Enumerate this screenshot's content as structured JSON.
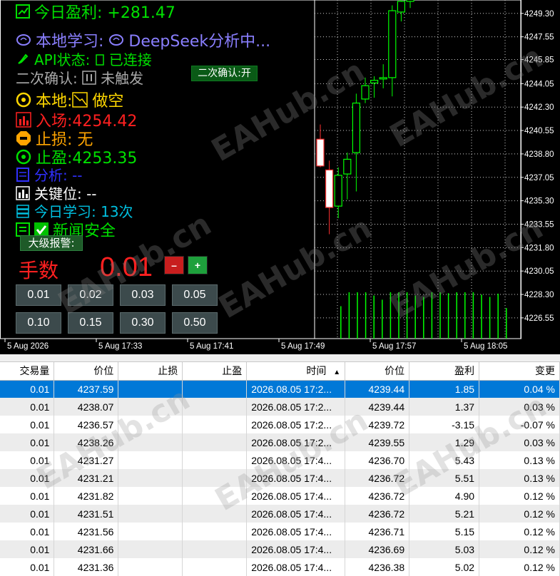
{
  "panel": {
    "profit_label": "今日盈利: +281.47",
    "ai_label": "本地学习: ",
    "ai_model": "DeepSeek分析中...",
    "api_label": "API状态: ",
    "api_status": "已连接",
    "confirm_label": "二次确认: ",
    "confirm_status": "未触发",
    "confirm_button": "二次确认:开",
    "local_label": "本地:",
    "local_status": "做空",
    "entry_label": "入场:4254.42",
    "sl_label": "止损: 无",
    "tp_label": "止盈:4253.35",
    "analysis_label": "分析: --",
    "key_label": "关键位: --",
    "learn_label": "今日学习: 13次",
    "news_label": "新闻安全",
    "alert_button": "大级报警:",
    "lots_label": "手数",
    "lots_value": "0.01",
    "minus": "–",
    "plus": "+",
    "lot_buttons": [
      "0.01",
      "0.02",
      "0.03",
      "0.05",
      "0.10",
      "0.15",
      "0.30",
      "0.50"
    ]
  },
  "colors": {
    "profit": "#00e000",
    "ai": "#8a7fff",
    "api": "#00e000",
    "confirm": "#aaaaaa",
    "local": "#ffd700",
    "entry": "#ff2020",
    "sl": "#ffa500",
    "tp": "#00e000",
    "analysis": "#3030ff",
    "key": "#ffffff",
    "learn": "#00c0e0",
    "news": "#00e000",
    "bull": "#00ff00",
    "bear": "#ff3030"
  },
  "chart_data": {
    "type": "candlestick",
    "price_ticks": [
      "4249.30",
      "4247.55",
      "4245.85",
      "4244.05",
      "4242.30",
      "4240.55",
      "4238.80",
      "4237.05",
      "4235.30",
      "4233.55",
      "4231.80",
      "4230.05",
      "4228.30",
      "4226.55"
    ],
    "time_ticks": [
      "5 Aug 2026",
      "5 Aug 17:33",
      "5 Aug 17:41",
      "5 Aug 17:49",
      "5 Aug 17:57",
      "5 Aug 18:05"
    ],
    "ylim": [
      4225.0,
      4250.3
    ],
    "candles": [
      {
        "o": 4239.9,
        "h": 4241.0,
        "l": 4237.8,
        "c": 4237.9
      },
      {
        "o": 4237.6,
        "h": 4238.3,
        "l": 4232.8,
        "c": 4234.8
      },
      {
        "o": 4234.9,
        "h": 4237.8,
        "l": 4234.0,
        "c": 4237.2
      },
      {
        "o": 4237.3,
        "h": 4238.9,
        "l": 4235.4,
        "c": 4238.4
      },
      {
        "o": 4238.9,
        "h": 4243.3,
        "l": 4236.0,
        "c": 4242.6
      },
      {
        "o": 4242.9,
        "h": 4244.5,
        "l": 4242.6,
        "c": 4243.9
      },
      {
        "o": 4244.1,
        "h": 4244.6,
        "l": 4243.0,
        "c": 4244.3
      },
      {
        "o": 4244.4,
        "h": 4245.5,
        "l": 4243.7,
        "c": 4244.5
      },
      {
        "o": 4244.5,
        "h": 4249.9,
        "l": 4243.1,
        "c": 4249.5
      },
      {
        "o": 4249.4,
        "h": 4250.6,
        "l": 4248.7,
        "c": 4250.2
      },
      {
        "o": 4250.2,
        "h": 4250.9,
        "l": 4249.7,
        "c": 4250.6
      }
    ],
    "volumes": [
      0,
      0,
      0,
      0.7,
      1,
      1,
      1,
      0.93,
      0.84,
      1,
      1,
      1,
      0.93,
      0.9,
      1,
      1,
      0.98,
      1,
      1,
      1,
      0.95,
      0.9,
      0.97,
      0.66
    ]
  },
  "table": {
    "headers": [
      "交易量",
      "价位",
      "止损",
      "止盈",
      "时间",
      "价位",
      "盈利",
      "变更"
    ],
    "sort_indicator": "▲",
    "rows": [
      [
        "0.01",
        "4237.59",
        "",
        "",
        "2026.08.05 17:2...",
        "4239.44",
        "1.85",
        "0.04 %"
      ],
      [
        "0.01",
        "4238.07",
        "",
        "",
        "2026.08.05 17:2...",
        "4239.44",
        "1.37",
        "0.03 %"
      ],
      [
        "0.01",
        "4236.57",
        "",
        "",
        "2026.08.05 17:2...",
        "4239.72",
        "-3.15",
        "-0.07 %"
      ],
      [
        "0.01",
        "4238.26",
        "",
        "",
        "2026.08.05 17:2...",
        "4239.55",
        "1.29",
        "0.03 %"
      ],
      [
        "0.01",
        "4231.27",
        "",
        "",
        "2026.08.05 17:4...",
        "4236.70",
        "5.43",
        "0.13 %"
      ],
      [
        "0.01",
        "4231.21",
        "",
        "",
        "2026.08.05 17:4...",
        "4236.72",
        "5.51",
        "0.13 %"
      ],
      [
        "0.01",
        "4231.82",
        "",
        "",
        "2026.08.05 17:4...",
        "4236.72",
        "4.90",
        "0.12 %"
      ],
      [
        "0.01",
        "4231.51",
        "",
        "",
        "2026.08.05 17:4...",
        "4236.72",
        "5.21",
        "0.12 %"
      ],
      [
        "0.01",
        "4231.56",
        "",
        "",
        "2026.08.05 17:4...",
        "4236.71",
        "5.15",
        "0.12 %"
      ],
      [
        "0.01",
        "4231.66",
        "",
        "",
        "2026.08.05 17:4...",
        "4236.69",
        "5.03",
        "0.12 %"
      ],
      [
        "0.01",
        "4231.36",
        "",
        "",
        "2026.08.05 17:4...",
        "4236.38",
        "5.02",
        "0.12 %"
      ]
    ]
  },
  "watermark": "EAHub.cn"
}
